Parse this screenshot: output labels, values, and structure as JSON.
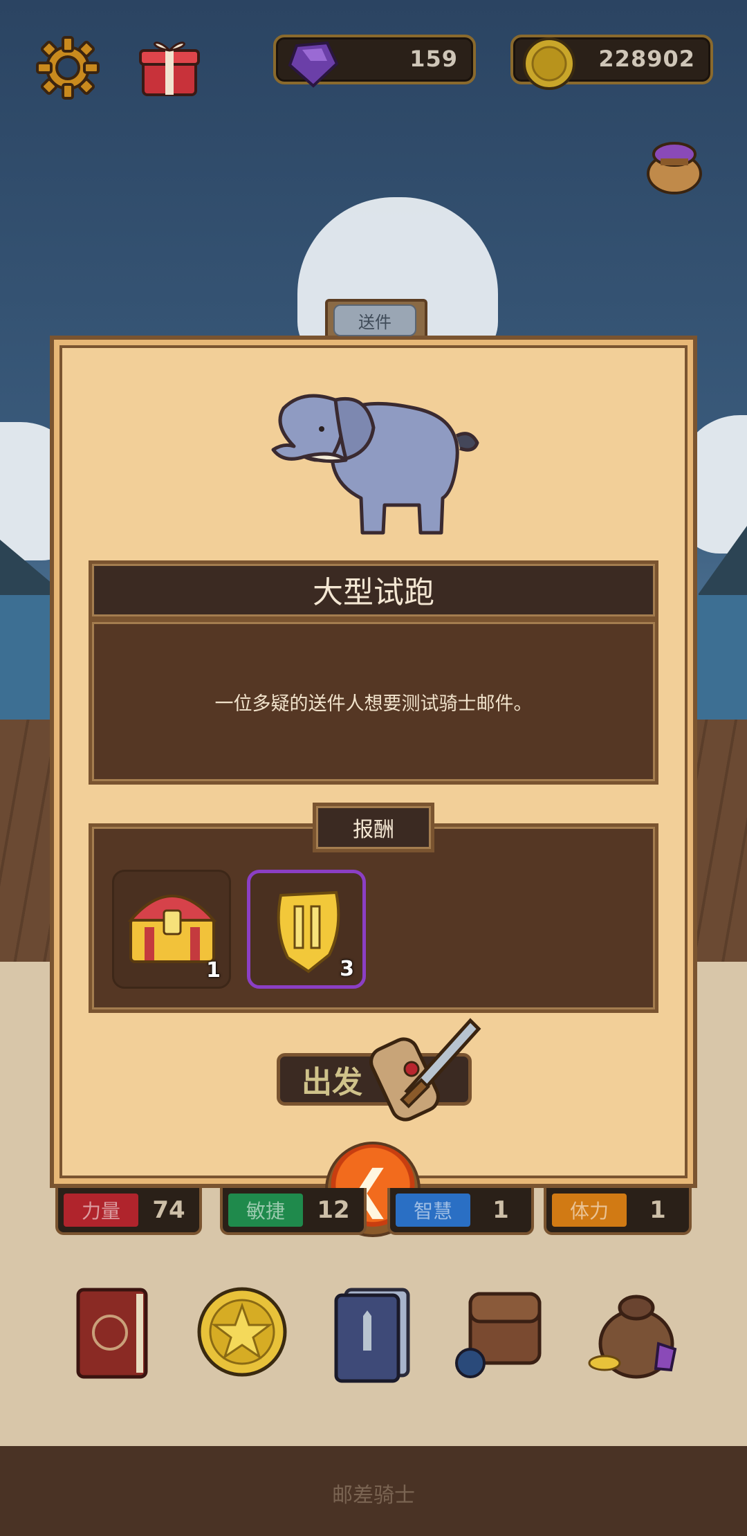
{
  "topbar": {
    "settings_icon": "gear-icon",
    "gift_icon": "gift-box-icon",
    "gems": "159",
    "coins": "228902",
    "pouch_icon": "magic-pouch-icon"
  },
  "dialog": {
    "tab_label": "送件",
    "title": "大型试跑",
    "description": "一位多疑的送件人想要测试骑士邮件。",
    "rewards_label": "报酬",
    "rewards": [
      {
        "icon": "treasure-chest-icon",
        "count": "1"
      },
      {
        "icon": "golden-crest-icon",
        "count": "3"
      }
    ],
    "go_label": "出发",
    "back_icon": "chevron-left-icon"
  },
  "stats": [
    {
      "label": "力量",
      "value": "74",
      "color": "#b0242c"
    },
    {
      "label": "敏捷",
      "value": "12",
      "color": "#1f8a4c"
    },
    {
      "label": "智慧",
      "value": "1",
      "color": "#2a6fc4"
    },
    {
      "label": "体力",
      "value": "1",
      "color": "#d17a14"
    }
  ],
  "menu": [
    "spellbook-icon",
    "star-coin-icon",
    "card-deck-icon",
    "backpack-icon",
    "treasure-bag-icon"
  ],
  "footer": {
    "title": "邮差骑士"
  },
  "colors": {
    "parchment": "#f2cf98",
    "wood_dark": "#3b2a22",
    "accent_orange": "#f26b1d",
    "rare_purple": "#8b3fc4"
  }
}
